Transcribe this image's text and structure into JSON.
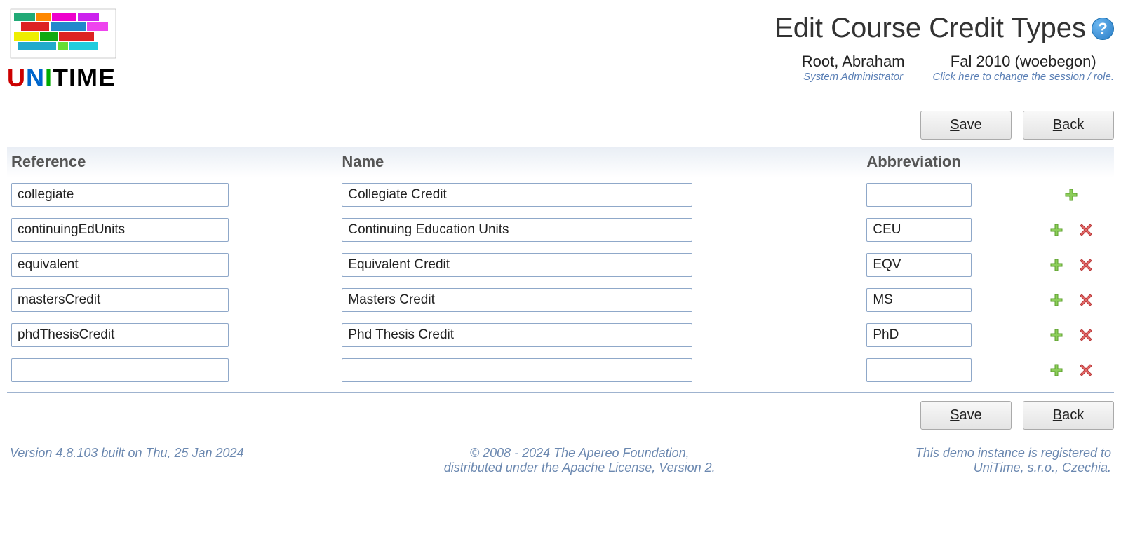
{
  "header": {
    "brand_u": "U",
    "brand_n": "N",
    "brand_i": "I",
    "brand_t": "T",
    "brand_i2": "I",
    "brand_m": "M",
    "brand_e": "E",
    "title": "Edit Course Credit Types",
    "help_glyph": "?",
    "user": {
      "name": "Root, Abraham",
      "role": "System Administrator"
    },
    "session": {
      "name": "Fal 2010 (woebegon)",
      "hint": "Click here to change the session / role."
    }
  },
  "buttons": {
    "save": "Save",
    "back": "Back"
  },
  "columns": {
    "reference": "Reference",
    "name": "Name",
    "abbreviation": "Abbreviation"
  },
  "rows": [
    {
      "reference": "collegiate",
      "name": "Collegiate Credit",
      "abbreviation": "",
      "can_delete": false
    },
    {
      "reference": "continuingEdUnits",
      "name": "Continuing Education Units",
      "abbreviation": "CEU",
      "can_delete": true
    },
    {
      "reference": "equivalent",
      "name": "Equivalent Credit",
      "abbreviation": "EQV",
      "can_delete": true
    },
    {
      "reference": "mastersCredit",
      "name": "Masters Credit",
      "abbreviation": "MS",
      "can_delete": true
    },
    {
      "reference": "phdThesisCredit",
      "name": "Phd Thesis Credit",
      "abbreviation": "PhD",
      "can_delete": true
    },
    {
      "reference": "",
      "name": "",
      "abbreviation": "",
      "can_delete": true
    }
  ],
  "footer": {
    "left": "Version 4.8.103 built on Thu, 25 Jan 2024",
    "mid1": "© 2008 - 2024 The Apereo Foundation,",
    "mid2": "distributed under the Apache License, Version 2.",
    "right1": "This demo instance is registered to",
    "right2": "UniTime, s.r.o., Czechia."
  }
}
